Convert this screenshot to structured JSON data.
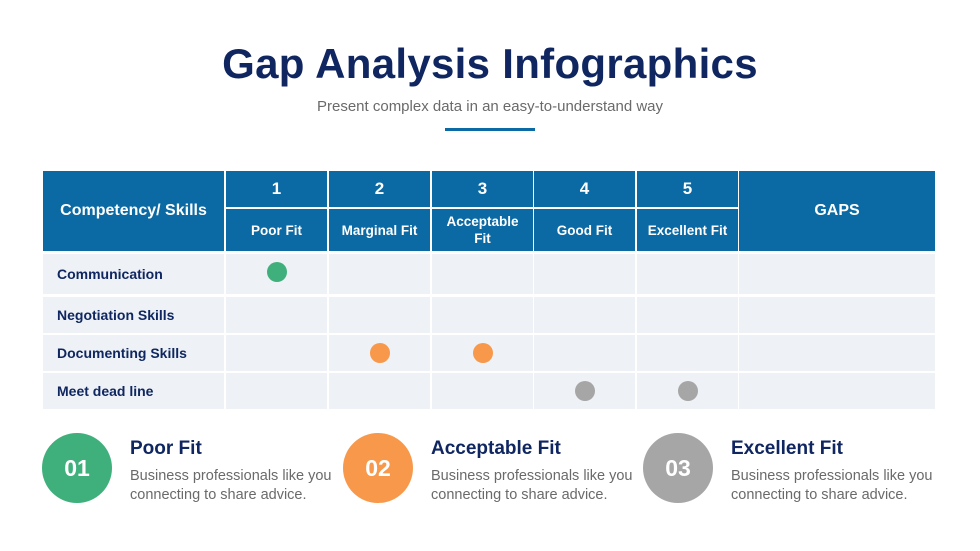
{
  "header": {
    "title": "Gap Analysis Infographics",
    "subtitle": "Present complex data in an easy-to-understand way"
  },
  "table": {
    "corner_label": "Competency/ Skills",
    "gaps_label": "GAPS",
    "columns": [
      {
        "number": "1",
        "label": "Poor Fit"
      },
      {
        "number": "2",
        "label": "Marginal Fit"
      },
      {
        "number": "3",
        "label": "Acceptable Fit"
      },
      {
        "number": "4",
        "label": "Good Fit"
      },
      {
        "number": "5",
        "label": "Excellent Fit"
      }
    ],
    "rows": [
      {
        "label": "Communication",
        "marks": [
          {
            "column": 1,
            "color": "#3fb07b"
          }
        ]
      },
      {
        "label": "Negotiation Skills",
        "marks": []
      },
      {
        "label": "Documenting Skills",
        "marks": [
          {
            "column": 2,
            "color": "#f7984a"
          },
          {
            "column": 3,
            "color": "#f7984a"
          }
        ]
      },
      {
        "label": "Meet dead line",
        "marks": [
          {
            "column": 4,
            "color": "#a6a6a6"
          },
          {
            "column": 5,
            "color": "#a6a6a6"
          }
        ]
      }
    ]
  },
  "legend": [
    {
      "number": "01",
      "title": "Poor Fit",
      "description": "Business professionals like you connecting to share advice.",
      "color": "#3fb07b"
    },
    {
      "number": "02",
      "title": "Acceptable Fit",
      "description": "Business professionals like you connecting to share advice.",
      "color": "#f7984a"
    },
    {
      "number": "03",
      "title": "Excellent Fit",
      "description": "Business professionals like you connecting to share advice.",
      "color": "#a6a6a6"
    }
  ],
  "colors": {
    "header_blue": "#0b69a3",
    "title_navy": "#0f2660",
    "row_bg": "#eef1f5"
  }
}
